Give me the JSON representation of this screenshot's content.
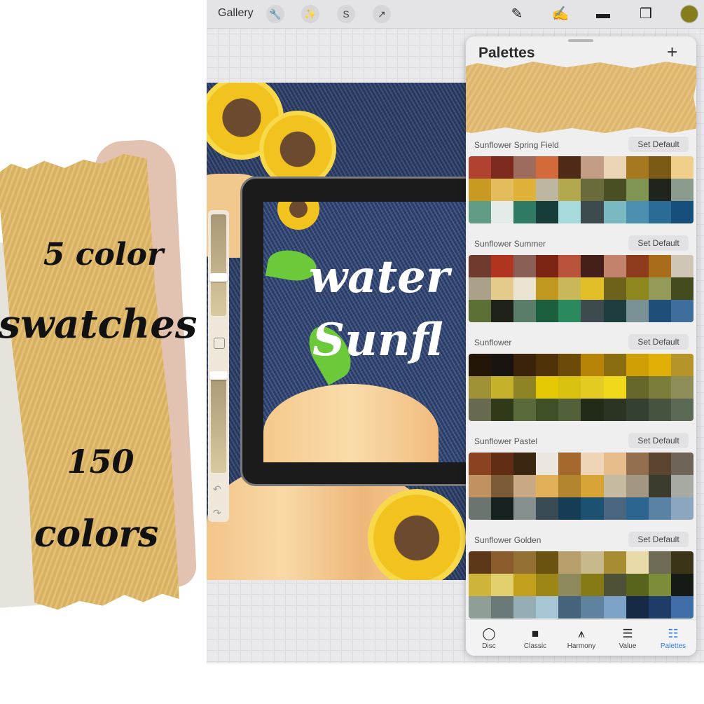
{
  "promo": {
    "line1": "5 color",
    "line2": "swatches",
    "line3": "150",
    "line4": "colors",
    "colors": {
      "gold": "#e2ba68",
      "pink": "#e2c3b2",
      "grey": "#e6e3dd"
    }
  },
  "toolbar": {
    "gallery_label": "Gallery",
    "icons": [
      "wrench-icon",
      "magic-wand-icon",
      "selection-icon",
      "transform-arrow-icon",
      "brush-icon",
      "smudge-icon",
      "eraser-icon",
      "layers-icon"
    ],
    "current_color": "#857c1c"
  },
  "canvas": {
    "art_text_line1": "water",
    "art_text_line2": "Sunfl"
  },
  "panel": {
    "title": "Palettes",
    "add_label": "+",
    "palettes": [
      {
        "name": "Sunflower Spring Field",
        "button": "Set Default",
        "colors": [
          "#b0432f",
          "#7d2a1e",
          "#9e6c5e",
          "#d4693a",
          "#4f2a17",
          "#c29c85",
          "#ecd4b7",
          "#a6781f",
          "#7a5a14",
          "#f0cf8a",
          "#c89a22",
          "#e3bd5b",
          "#e0b138",
          "#bdb7a2",
          "#b3a84e",
          "#6a6b3b",
          "#4a4f23",
          "#7f9553",
          "#1f241c",
          "#8b9b8e",
          "#5f9c83",
          "#e3ece8",
          "#2f7a63",
          "#173d3a",
          "#a8dcdc",
          "#3d4a4d",
          "#7ab9c1",
          "#4d8fae",
          "#2a6c96",
          "#174f7c"
        ]
      },
      {
        "name": "Sunflower Summer",
        "button": "Set Default",
        "colors": [
          "#6f3b2f",
          "#b03420",
          "#8a5f55",
          "#7b2414",
          "#b9523a",
          "#45201a",
          "#c3826c",
          "#8d3b1c",
          "#a86c1a",
          "#cfc6b6",
          "#aba08a",
          "#e4ca8b",
          "#ece4d2",
          "#c09820",
          "#c9b85a",
          "#e0bf28",
          "#6e621b",
          "#8e871f",
          "#949a58",
          "#434b1f",
          "#5c6f35",
          "#1e221a",
          "#5a7d6a",
          "#1b5e3d",
          "#2a8a5d",
          "#3d4b4c",
          "#203d3e",
          "#7a9196",
          "#1f4f78",
          "#3f6d9c"
        ]
      },
      {
        "name": "Sunflower",
        "button": "Set Default",
        "colors": [
          "#231608",
          "#1a1410",
          "#3b2309",
          "#4f3208",
          "#6b4a0a",
          "#b78407",
          "#8a6d10",
          "#cf9f05",
          "#e0b006",
          "#b5952a",
          "#9e9136",
          "#c5b22a",
          "#8f8425",
          "#e6c905",
          "#d9c20f",
          "#e4cb22",
          "#f0d91a",
          "#64662a",
          "#7b7d3a",
          "#8d8d59",
          "#676a4e",
          "#303a19",
          "#5a6a3a",
          "#3f4f26",
          "#53613b",
          "#222a18",
          "#2b3423",
          "#344030",
          "#46543f",
          "#5b6a55"
        ]
      },
      {
        "name": "Sunflower Pastel",
        "button": "Set Default",
        "colors": [
          "#8a4221",
          "#622d15",
          "#3b2611",
          "#ebe6e0",
          "#a4682d",
          "#efd5b7",
          "#e7bc8c",
          "#936f4f",
          "#5b4530",
          "#6e6457",
          "#c09262",
          "#7b5c36",
          "#c9a884",
          "#e3b05a",
          "#b4852f",
          "#d8a438",
          "#c6baa0",
          "#a39682",
          "#3b3c2e",
          "#a7aaa3",
          "#6c746f",
          "#16221f",
          "#858f8e",
          "#3a4a54",
          "#173c55",
          "#1d5171",
          "#4b6680",
          "#2b6590",
          "#5a82a4",
          "#8da6bf"
        ]
      },
      {
        "name": "Sunflower Golden",
        "button": "Set Default",
        "colors": [
          "#5c3818",
          "#8a5c2b",
          "#946f34",
          "#6a5210",
          "#b79f6b",
          "#c8b98c",
          "#a68d32",
          "#e8dba9",
          "#6d6a55",
          "#3b3517",
          "#cfb43c",
          "#e2cf6d",
          "#c2a01e",
          "#9b8616",
          "#8f8a5e",
          "#857a16",
          "#4f5136",
          "#58631b",
          "#7c8d3a",
          "#151a15",
          "#8f9e97",
          "#6a7a78",
          "#95aeb5",
          "#a6c6d6",
          "#45637a",
          "#5f839e",
          "#7ca2c8",
          "#172a45",
          "#1e3c67",
          "#3f6ea8"
        ]
      }
    ],
    "tabs": [
      {
        "label": "Disc",
        "icon": "disc-icon"
      },
      {
        "label": "Classic",
        "icon": "classic-square-icon"
      },
      {
        "label": "Harmony",
        "icon": "harmony-icon"
      },
      {
        "label": "Value",
        "icon": "value-sliders-icon"
      },
      {
        "label": "Palettes",
        "icon": "palettes-grid-icon"
      }
    ],
    "active_tab": "Palettes"
  }
}
